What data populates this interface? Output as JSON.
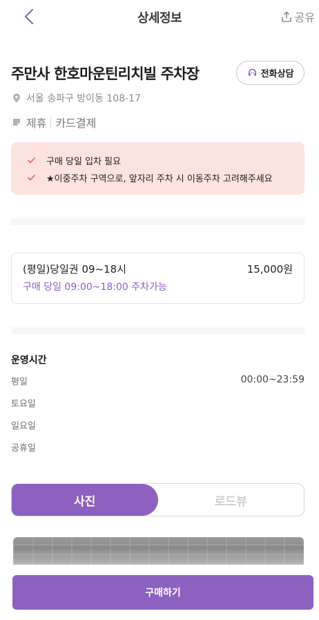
{
  "header": {
    "title": "상세정보",
    "share_label": "공유"
  },
  "place": {
    "name": "주만사 한호마운틴리치빌 주차장",
    "call_label": "전화상담",
    "address": "서울 송파구 방이동 108-17",
    "tags": [
      "제휴",
      "카드결제"
    ]
  },
  "notices": [
    "구매 당일 입차 필요",
    "★이중주차 구역으로, 앞자리 주차 시 이동주차 고려해주세요"
  ],
  "ticket": {
    "name": "(평일)당일권 09~18시",
    "price": "15,000원",
    "desc": "구매 당일 09:00~18:00 주차가능"
  },
  "hours": {
    "title": "운영시간",
    "rows": [
      {
        "label": "평일",
        "value": "00:00~23:59"
      },
      {
        "label": "토요일",
        "value": ""
      },
      {
        "label": "일요일",
        "value": ""
      },
      {
        "label": "공휴일",
        "value": ""
      }
    ]
  },
  "media_toggle": {
    "options": [
      "사진",
      "로드뷰"
    ],
    "selected": "사진"
  },
  "cta": {
    "buy_label": "구매하기"
  },
  "colors": {
    "accent": "#8c61bf",
    "notice_bg": "#fde3df",
    "check": "#e0644f"
  }
}
